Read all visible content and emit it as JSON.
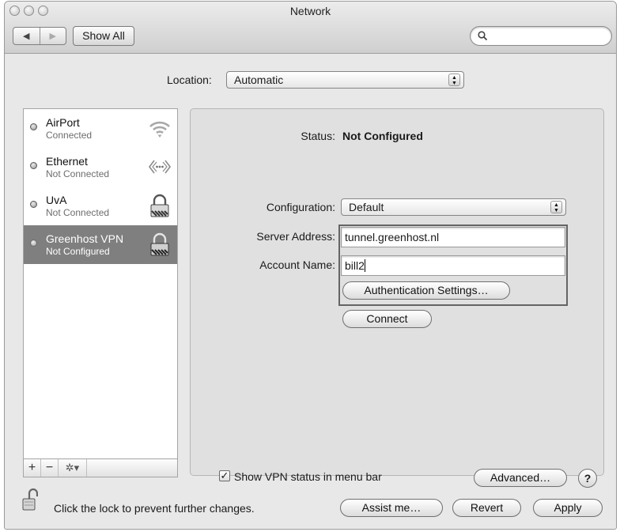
{
  "window": {
    "title": "Network"
  },
  "toolbar": {
    "back_glyph": "◀",
    "forward_glyph": "▶",
    "show_all_label": "Show All",
    "search_value": ""
  },
  "location": {
    "label": "Location:",
    "selected": "Automatic"
  },
  "sidebar": {
    "services": [
      {
        "name": "AirPort",
        "status": "Connected",
        "icon": "wifi-icon"
      },
      {
        "name": "Ethernet",
        "status": "Not Connected",
        "icon": "ethernet-icon"
      },
      {
        "name": "UvA",
        "status": "Not Connected",
        "icon": "vpn-lock-icon"
      },
      {
        "name": "Greenhost VPN",
        "status": "Not Configured",
        "icon": "vpn-lock-icon",
        "selected": true
      }
    ],
    "add_label": "+",
    "remove_label": "−",
    "action_label": "✲▾"
  },
  "detail": {
    "status_label": "Status:",
    "status_value": "Not Configured",
    "configuration_label": "Configuration:",
    "configuration_value": "Default",
    "server_address_label": "Server Address:",
    "server_address_value": "tunnel.greenhost.nl",
    "account_name_label": "Account Name:",
    "account_name_value": "bill2",
    "auth_settings_label": "Authentication Settings…",
    "connect_label": "Connect",
    "show_vpn_status_label": "Show VPN status in menu bar",
    "show_vpn_status_checked": true,
    "checkmark": "✓",
    "advanced_label": "Advanced…",
    "help_label": "?"
  },
  "footer": {
    "lock_text": "Click the lock to prevent further changes.",
    "assist_label": "Assist me…",
    "revert_label": "Revert",
    "apply_label": "Apply"
  }
}
